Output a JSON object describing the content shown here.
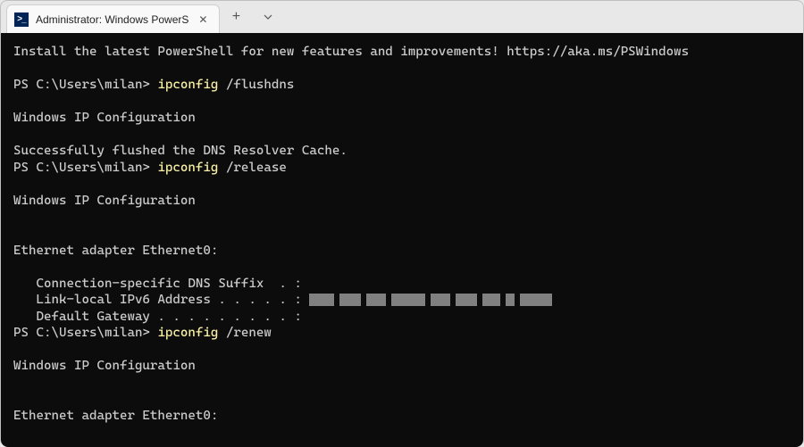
{
  "tab": {
    "title": "Administrator: Windows PowerS"
  },
  "terminal": {
    "banner": "Install the latest PowerShell for new features and improvements! https://aka.ms/PSWindows",
    "prompt_path": "PS C:\\Users\\milan>",
    "cmd1": "ipconfig",
    "arg1": "/flushdns",
    "cmd2": "ipconfig",
    "arg2": "/release",
    "cmd3": "ipconfig",
    "arg3": "/renew",
    "ipconfig_header": "Windows IP Configuration",
    "flush_success": "Successfully flushed the DNS Resolver Cache.",
    "adapter_header": "Ethernet adapter Ethernet0:",
    "dns_suffix_label": "   Connection-specific DNS Suffix  . :",
    "link_local_label": "   Link-local IPv6 Address . . . . . : ",
    "default_gateway_label": "   Default Gateway . . . . . . . . . :"
  }
}
